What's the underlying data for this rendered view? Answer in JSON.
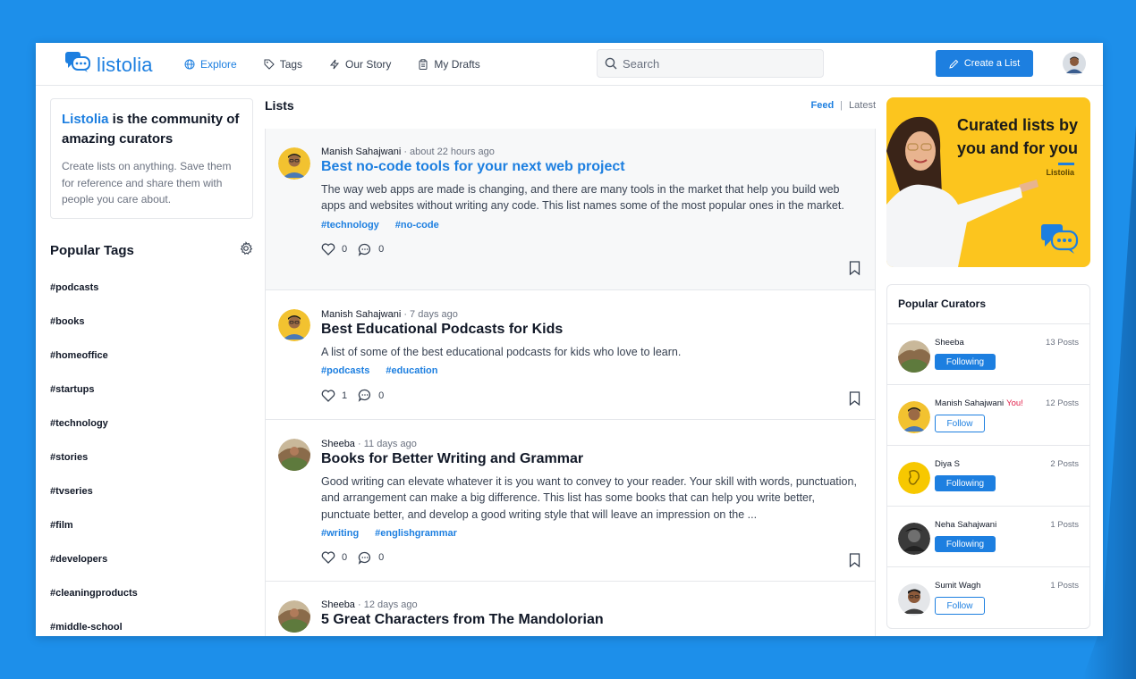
{
  "app": {
    "name": "listolia"
  },
  "nav": {
    "items": [
      {
        "label": "Explore",
        "icon": "globe-icon",
        "active": true
      },
      {
        "label": "Tags",
        "icon": "tag-icon",
        "active": false
      },
      {
        "label": "Our Story",
        "icon": "bolt-icon",
        "active": false
      },
      {
        "label": "My Drafts",
        "icon": "clipboard-icon",
        "active": false
      }
    ]
  },
  "search": {
    "placeholder": "Search",
    "value": ""
  },
  "header": {
    "create_label": "Create a List"
  },
  "intro": {
    "brand": "Listolia",
    "title_rest": " is the community of amazing curators",
    "description": "Create lists on anything. Save them for reference and share them with people you care about."
  },
  "tags": {
    "title": "Popular Tags",
    "items": [
      "#podcasts",
      "#books",
      "#homeoffice",
      "#startups",
      "#technology",
      "#stories",
      "#tvseries",
      "#film",
      "#developers",
      "#cleaningproducts",
      "#middle-school"
    ]
  },
  "lists": {
    "title": "Lists",
    "sort_feed": "Feed",
    "sort_sep": "|",
    "sort_latest": "Latest",
    "posts": [
      {
        "author": "Manish Sahajwani",
        "time": " · about 22 hours ago",
        "title": "Best no-code tools for your next web project",
        "description": "The way web apps are made is changing, and there are many tools in the market that help you build web apps and websites without writing any code. This list names some of the most popular ones in the market.",
        "tags": [
          "#technology",
          "#no-code"
        ],
        "likes": "0",
        "comments": "0"
      },
      {
        "author": "Manish Sahajwani",
        "time": " · 7 days ago",
        "title": "Best Educational Podcasts for Kids",
        "description": "A list of some of the best educational podcasts for kids who love to learn.",
        "tags": [
          "#podcasts",
          "#education"
        ],
        "likes": "1",
        "comments": "0"
      },
      {
        "author": "Sheeba",
        "time": " · 11 days ago",
        "title": "Books for Better Writing and Grammar",
        "description": "Good writing can elevate whatever it is you want to convey to your reader. Your skill with words, punctuation, and arrangement can make a big difference. This list has some books that can help you write better, punctuate better, and develop a good writing style that will leave an impression on the ...",
        "tags": [
          "#writing",
          "#englishgrammar"
        ],
        "likes": "0",
        "comments": "0"
      },
      {
        "author": "Sheeba",
        "time": " · 12 days ago",
        "title": "5 Great Characters from The Mandolorian"
      }
    ]
  },
  "promo": {
    "headline": "Curated lists by you and for you",
    "brand": "Listolia"
  },
  "curators": {
    "title": "Popular Curators",
    "items": [
      {
        "name": "Sheeba",
        "you": "",
        "posts": "13 Posts",
        "button": "Following"
      },
      {
        "name": "Manish Sahajwani",
        "you": "You!",
        "posts": "12 Posts",
        "button": "Follow"
      },
      {
        "name": "Diya S",
        "you": "",
        "posts": "2 Posts",
        "button": "Following"
      },
      {
        "name": "Neha Sahajwani",
        "you": "",
        "posts": "1 Posts",
        "button": "Following"
      },
      {
        "name": "Sumit Wagh",
        "you": "",
        "posts": "1 Posts",
        "button": "Follow"
      }
    ]
  },
  "colors": {
    "accent": "#1d7fe0",
    "background": "#1d8fea",
    "promo": "#fcc51e",
    "you_badge": "#e11d48"
  }
}
